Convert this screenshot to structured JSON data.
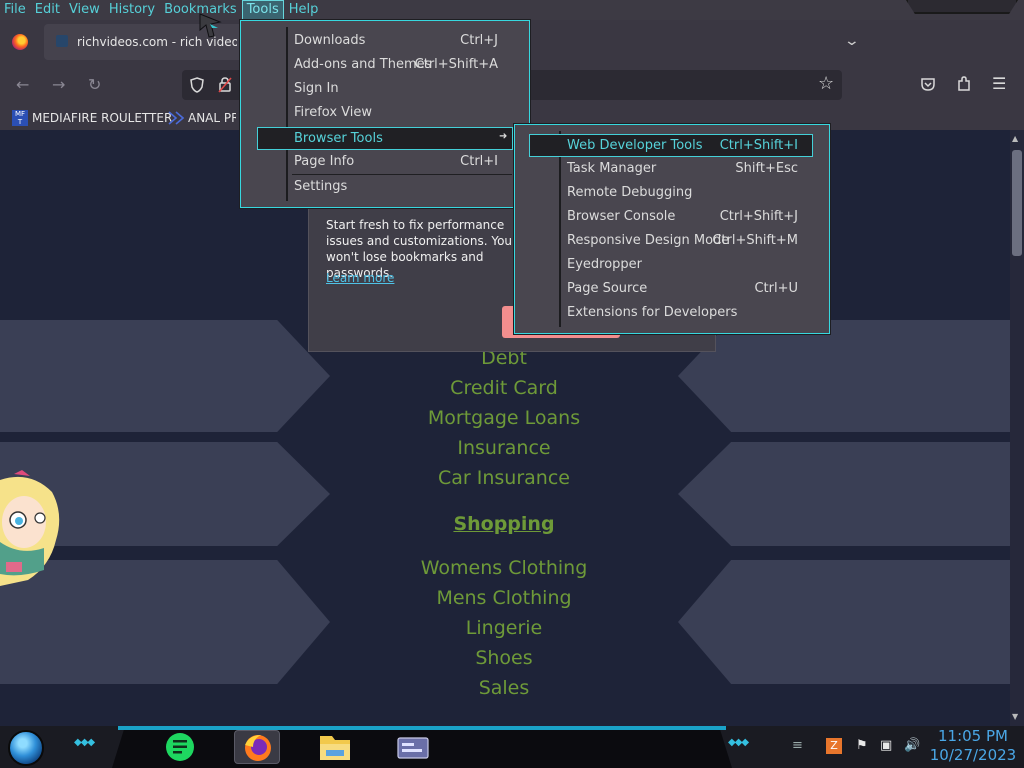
{
  "menubar": {
    "items": [
      "File",
      "Edit",
      "View",
      "History",
      "Bookmarks",
      "Tools",
      "Help"
    ],
    "active": "Tools"
  },
  "tab": {
    "title": "richvideos.com - rich videos R"
  },
  "bookmarks": {
    "items": [
      {
        "label": "MEDIAFIRE ROULETTER",
        "icon": "mediafire-icon"
      },
      {
        "label": "ANAL PRO",
        "icon": "bookmark-icon"
      }
    ]
  },
  "tools_menu": {
    "items": [
      {
        "label": "Downloads",
        "shortcut": "Ctrl+J"
      },
      {
        "label": "Add-ons and Themes",
        "shortcut": "Ctrl+Shift+A"
      },
      {
        "label": "Sign In",
        "shortcut": ""
      },
      {
        "label": "Firefox View",
        "shortcut": ""
      },
      {
        "label": "Browser Tools",
        "shortcut": "",
        "submenu": true
      },
      {
        "label": "Page Info",
        "shortcut": "Ctrl+I"
      },
      {
        "label": "Settings",
        "shortcut": ""
      }
    ],
    "highlighted": "Browser Tools"
  },
  "browser_tools_submenu": {
    "items": [
      {
        "label": "Web Developer Tools",
        "shortcut": "Ctrl+Shift+I"
      },
      {
        "label": "Task Manager",
        "shortcut": "Shift+Esc"
      },
      {
        "label": "Remote Debugging",
        "shortcut": ""
      },
      {
        "label": "Browser Console",
        "shortcut": "Ctrl+Shift+J"
      },
      {
        "label": "Responsive Design Mode",
        "shortcut": "Ctrl+Shift+M"
      },
      {
        "label": "Eyedropper",
        "shortcut": ""
      },
      {
        "label": "Page Source",
        "shortcut": "Ctrl+U"
      },
      {
        "label": "Extensions for Developers",
        "shortcut": ""
      }
    ],
    "highlighted": "Web Developer Tools"
  },
  "refresh_popup": {
    "text": "Start fresh to fix performance issues and customizations. You won't lose bookmarks and passwords.",
    "link": "Learn more"
  },
  "page": {
    "links_top": [
      "Debt",
      "Credit Card",
      "Mortgage Loans",
      "Insurance",
      "Car Insurance"
    ],
    "heading": "Shopping",
    "links_bottom": [
      "Womens Clothing",
      "Mens Clothing",
      "Lingerie",
      "Shoes",
      "Sales"
    ],
    "link_color": "#6e9a38"
  },
  "taskbar": {
    "apps": [
      "notes-app-icon",
      "firefox-icon",
      "file-explorer-icon",
      "window-app-icon"
    ],
    "active_app": "firefox-icon",
    "time": "11:05 PM",
    "date": "10/27/2023"
  },
  "theme": {
    "accent": "#37d8df",
    "menu_bg": "#49464f",
    "menubar_text": "#56d0d8"
  }
}
